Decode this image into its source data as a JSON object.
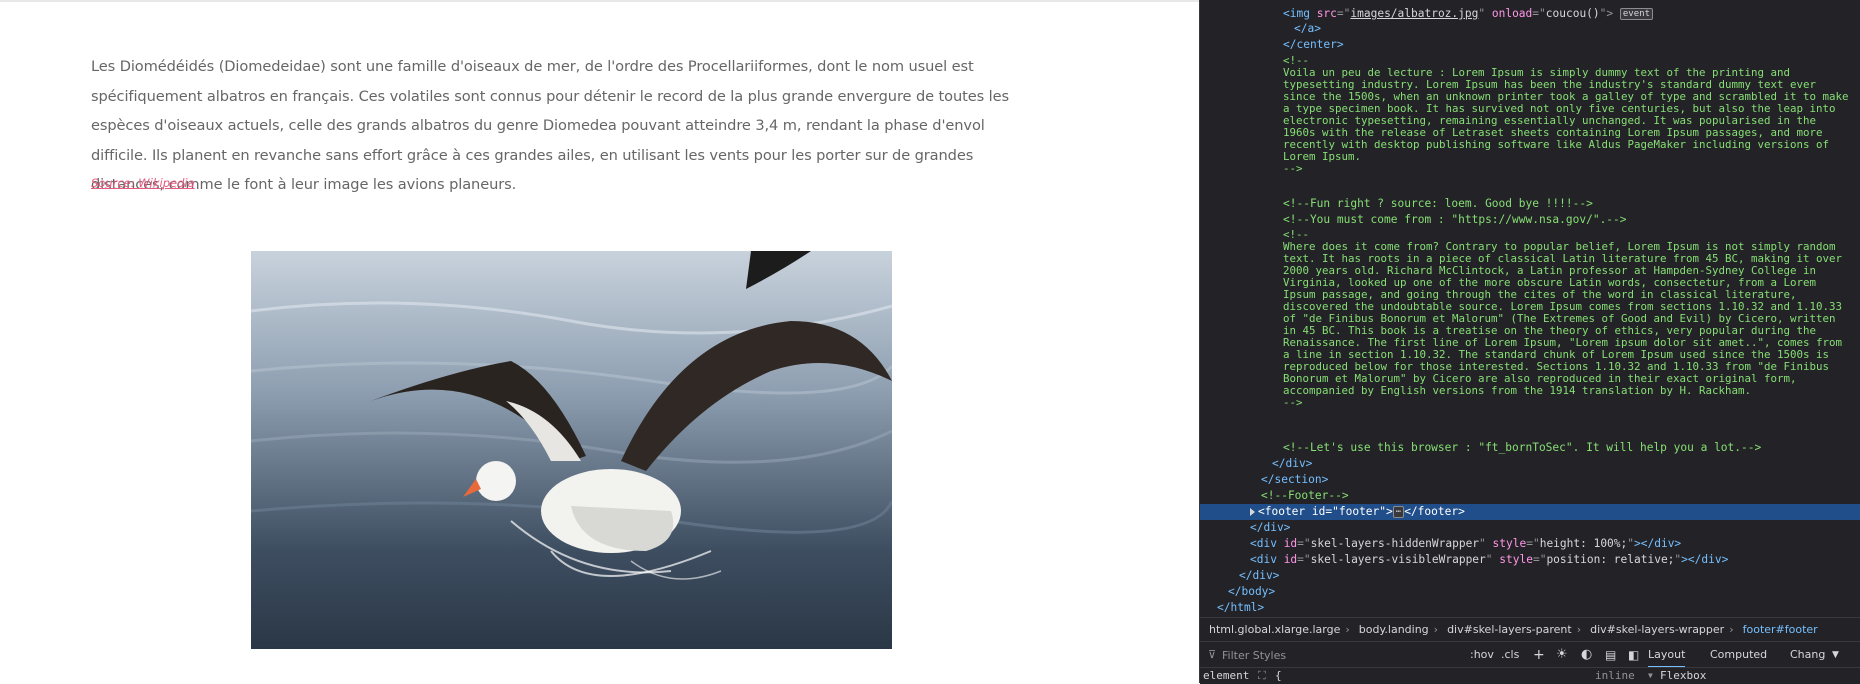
{
  "page": {
    "paragraph": "Les Diomédéidés (Diomedeidae) sont une famille d'oiseaux de mer, de l'ordre des Procellariiformes, dont le nom usuel est spécifiquement albatros en français. Ces volatiles sont connus pour détenir le record de la plus grande envergure de toutes les espèces d'oiseaux actuels, celle des grands albatros du genre Diomedea pouvant atteindre 3,4 m, rendant la phase d'envol difficile. Ils planent en revanche sans effort grâce à ces grandes ailes, en utilisant les vents pour les porter sur de grandes distances, comme le font à leur image les avions planeurs.",
    "source_link": "Source: Wikipedia",
    "image_subject": "albatross-photo"
  },
  "devtools": {
    "markup": {
      "img_line": {
        "tag_open": "<img ",
        "src_attr": "src",
        "eq1": "=\"",
        "src_val": "images/albatroz.jpg",
        "q1": "\" ",
        "onload_attr": "onload",
        "eq2": "=\"",
        "onload_val": "coucou()",
        "q2": "\">",
        "badge": "event"
      },
      "close_a": "</a>",
      "close_center": "</center>",
      "comment1": [
        "<!--",
        "Voila un peu de lecture : Lorem Ipsum is simply dummy text of the printing and",
        "typesetting industry. Lorem Ipsum has been the industry's standard dummy text ever",
        "since the 1500s, when an unknown printer took a galley of type and scrambled it to make",
        "a type specimen book. It has survived not only five centuries, but also the leap into",
        "electronic typesetting, remaining essentially unchanged. It was popularised in the",
        "1960s with the release of Letraset sheets containing Lorem Ipsum passages, and more",
        "recently with desktop publishing software like Aldus PageMaker including versions of",
        "Lorem Ipsum.",
        "-->"
      ],
      "comment2": "<!--Fun right ? source: loem. Good bye !!!!-->",
      "comment3": "<!--You must come from : \"https://www.nsa.gov/\".-->",
      "comment4": [
        "<!--",
        "Where does it come from? Contrary to popular belief, Lorem Ipsum is not simply random",
        "text. It has roots in a piece of classical Latin literature from 45 BC, making it over",
        "2000 years old. Richard McClintock, a Latin professor at Hampden-Sydney College in",
        "Virginia, looked up one of the more obscure Latin words, consectetur, from a Lorem",
        "Ipsum passage, and going through the cites of the word in classical literature,",
        "discovered the undoubtable source. Lorem Ipsum comes from sections 1.10.32 and 1.10.33",
        "of \"de Finibus Bonorum et Malorum\" (The Extremes of Good and Evil) by Cicero, written",
        "in 45 BC. This book is a treatise on the theory of ethics, very popular during the",
        "Renaissance. The first line of Lorem Ipsum, \"Lorem ipsum dolor sit amet..\", comes from",
        "a line in section 1.10.32. The standard chunk of Lorem Ipsum used since the 1500s is",
        "reproduced below for those interested. Sections 1.10.32 and 1.10.33 from \"de Finibus",
        "Bonorum et Malorum\" by Cicero are also reproduced in their exact original form,",
        "accompanied by English versions from the 1914 translation by H. Rackham.",
        "-->"
      ],
      "comment5": "<!--Let's use this browser : \"ft_bornToSec\". It will help you a lot.-->",
      "close_div": "</div>",
      "close_section": "</section>",
      "comment_footer": "<!--Footer-->",
      "footer_line": {
        "open": "<footer ",
        "attr": "id",
        "eq": "=\"",
        "val": "footer",
        "close": "\">",
        "ellipsis": "⋯",
        "end": "</footer>"
      },
      "close_div2": "</div>",
      "hidden_wrapper": {
        "open": "<div ",
        "id_attr": "id",
        "id_val": "skel-layers-hiddenWrapper",
        "style_attr": "style",
        "style_val": "height: 100%;",
        "end": "></div>"
      },
      "visible_wrapper": {
        "open": "<div ",
        "id_attr": "id",
        "id_val": "skel-layers-visibleWrapper",
        "style_attr": "style",
        "style_val": "position: relative;",
        "end": "></div>"
      },
      "close_div3": "</div>",
      "close_body": "</body>",
      "close_html": "</html>"
    },
    "breadcrumbs": [
      "html.global.xlarge.large",
      "body.landing",
      "div#skel-layers-parent",
      "div#skel-layers-wrapper",
      "footer#footer"
    ],
    "filter_placeholder": "Filter Styles",
    "tools": {
      "hov": ":hov",
      "cls": ".cls",
      "add": "+"
    },
    "tabs": {
      "layout": "Layout",
      "computed": "Computed",
      "changes": "Chang"
    },
    "rules": {
      "selector": "element",
      "brace": "{",
      "source": "inline",
      "flexbox": "Flexbox"
    }
  }
}
